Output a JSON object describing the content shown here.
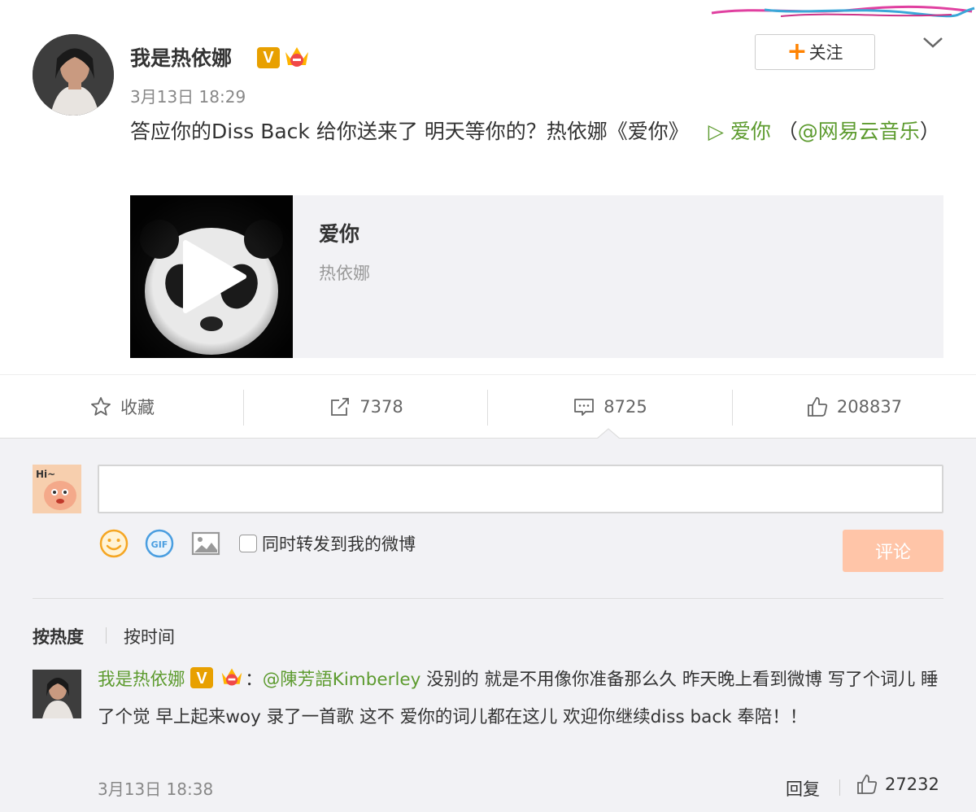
{
  "post": {
    "username": "我是热依娜",
    "timestamp": "3月13日 18:29",
    "follow_label": "关注",
    "text_part1": "答应你的Diss Back 给你送来了 明天等你的？热依娜《爱你》",
    "music_link": "▷ 爱你",
    "text_part2": "（",
    "mention": "@网易云音乐",
    "text_part3": "）",
    "music_card": {
      "title": "爱你",
      "artist": "热依娜"
    }
  },
  "actions": {
    "favorite_label": "收藏",
    "repost_count": "7378",
    "comment_count": "8725",
    "like_count": "208837"
  },
  "composer": {
    "repost_label": "同时转发到我的微博",
    "submit_label": "评论",
    "avatar_text": "Hi~"
  },
  "sort": {
    "hot_label": "按热度",
    "time_label": "按时间"
  },
  "comment": {
    "username": "我是热依娜",
    "colon": "：",
    "mention": "@陳芳語Kimberley",
    "text": " 没别的 就是不用像你准备那么久 昨天晚上看到微博 写了个词儿 睡了个觉 早上起来woy 录了一首歌 这不 爱你的词儿都在这儿 欢迎你继续diss back 奉陪！！",
    "timestamp": "3月13日 18:38",
    "reply_label": "回复",
    "like_count": "27232"
  },
  "colors": {
    "accent_orange": "#ff8200",
    "link_green": "#5d9b2f",
    "verified_gold": "#e8a000",
    "submit_disabled": "#ffc5a8"
  }
}
